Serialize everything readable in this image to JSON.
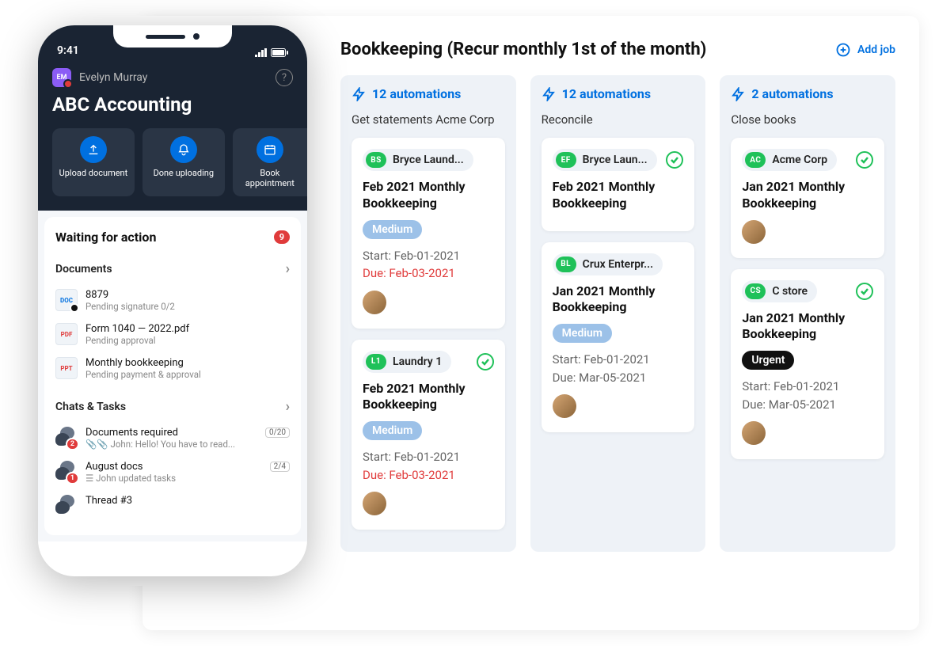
{
  "board": {
    "title": "Bookkeeping (Recur monthly 1st of the month)",
    "add_job_label": "Add job"
  },
  "columns": [
    {
      "automations": "12 automations",
      "title": "Get statements Acme Corp",
      "cards": [
        {
          "client_initials": "BS",
          "client_name": "Bryce Laund...",
          "has_check": false,
          "title": "Feb 2021 Monthly Bookkeeping",
          "priority": "Medium",
          "priority_class": "medium",
          "start": "Start: Feb-01-2021",
          "due": "Due: Feb-03-2021",
          "due_overdue": true,
          "avatar": true
        },
        {
          "client_initials": "L1",
          "client_name": "Laundry 1",
          "has_check": true,
          "title": "Feb 2021 Monthly Bookkeeping",
          "priority": "Medium",
          "priority_class": "medium",
          "start": "Start: Feb-01-2021",
          "due": "Due: Feb-03-2021",
          "due_overdue": true,
          "avatar": true
        }
      ]
    },
    {
      "automations": "12 automations",
      "title": "Reconcile",
      "cards": [
        {
          "client_initials": "EF",
          "client_name": "Bryce Laun...",
          "has_check": true,
          "title": "Feb 2021 Monthly Bookkeeping",
          "priority": "",
          "priority_class": "",
          "start": "",
          "due": "",
          "due_overdue": false,
          "avatar": false
        },
        {
          "client_initials": "BL",
          "client_name": "Crux Enterpr...",
          "has_check": false,
          "title": "Jan 2021 Monthly Bookkeeping",
          "priority": "Medium",
          "priority_class": "medium",
          "start": "Start: Feb-01-2021",
          "due": "Due: Mar-05-2021",
          "due_overdue": false,
          "avatar": true
        }
      ]
    },
    {
      "automations": "2 automations",
      "title": "Close books",
      "cards": [
        {
          "client_initials": "AC",
          "client_name": "Acme Corp",
          "has_check": true,
          "title": "Jan 2021 Monthly Bookkeeping",
          "priority": "",
          "priority_class": "",
          "start": "",
          "due": "",
          "due_overdue": false,
          "avatar": true
        },
        {
          "client_initials": "CS",
          "client_name": "C store",
          "has_check": true,
          "title": "Jan 2021 Monthly Bookkeeping",
          "priority": "Urgent",
          "priority_class": "urgent",
          "start": "Start: Feb-01-2021",
          "due": "Due: Mar-05-2021",
          "due_overdue": false,
          "avatar": true
        }
      ]
    }
  ],
  "phone": {
    "time": "9:41",
    "user_initials": "EM",
    "user_name": "Evelyn Murray",
    "firm_name": "ABC Accounting",
    "actions": [
      {
        "label": "Upload document"
      },
      {
        "label": "Done uploading"
      },
      {
        "label": "Book appointment"
      }
    ],
    "waiting_title": "Waiting for action",
    "waiting_count": "9",
    "documents_label": "Documents",
    "documents": [
      {
        "icon": "doc",
        "title": "8879",
        "meta": "Pending signature 0/2",
        "lock": true
      },
      {
        "icon": "pdf",
        "title": "Form 1040 — 2022.pdf",
        "meta": "Pending approval",
        "lock": false
      },
      {
        "icon": "ppt",
        "title": "Monthly bookkeeping",
        "meta": "Pending payment & approval",
        "lock": false
      }
    ],
    "chats_label": "Chats & Tasks",
    "chats": [
      {
        "badge": "2",
        "title": "Documents required",
        "count": "0/20",
        "meta": "📎📎 John: Hello! You have to read..."
      },
      {
        "badge": "1",
        "title": "August docs",
        "count": "2/4",
        "meta": "☰ John updated tasks"
      },
      {
        "badge": "",
        "title": "Thread #3",
        "count": "",
        "meta": ""
      }
    ]
  }
}
